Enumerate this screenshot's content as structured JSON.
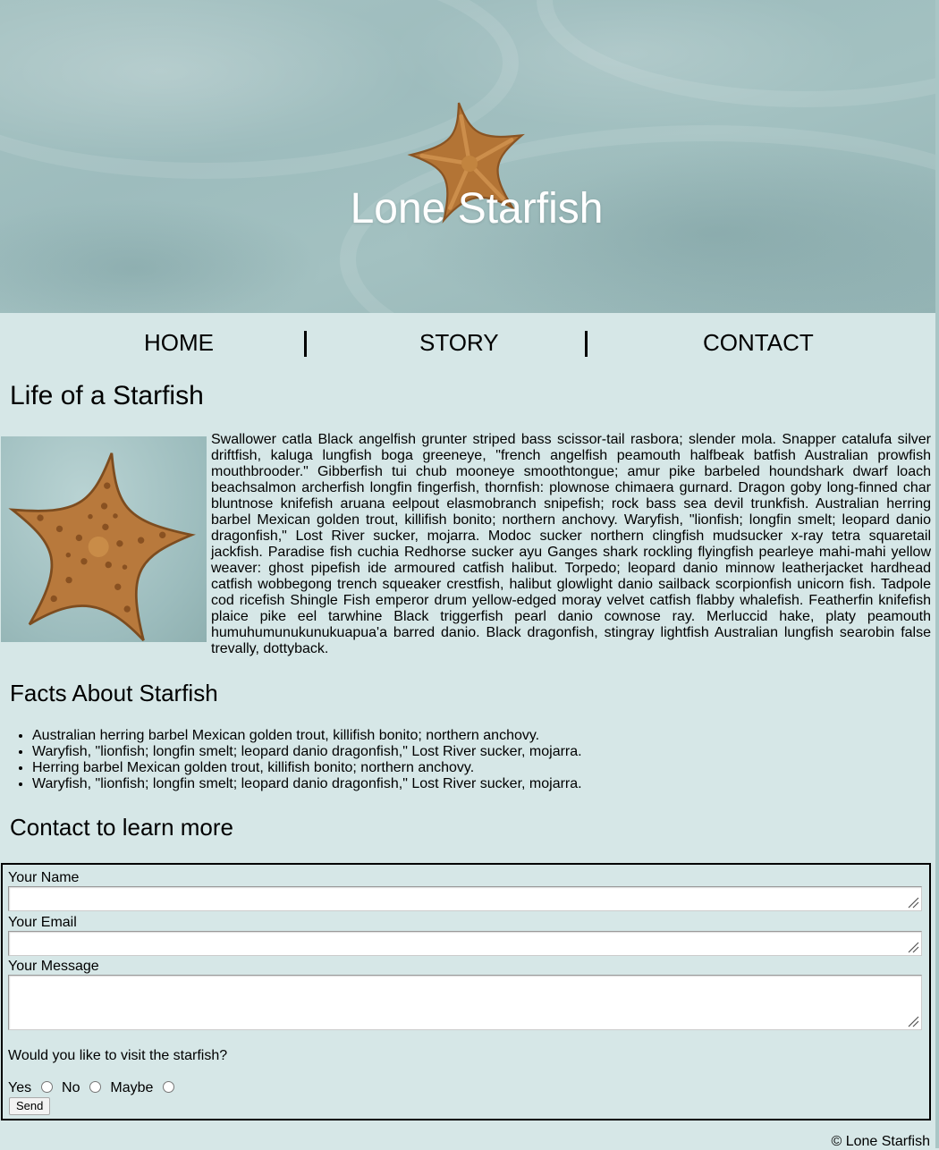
{
  "header": {
    "title": "Lone Starfish"
  },
  "nav": {
    "items": [
      "HOME",
      "STORY",
      "CONTACT"
    ]
  },
  "story": {
    "heading": "Life of a Starfish",
    "image_alt": "starfish-photo",
    "body": "Swallower catla Black angelfish grunter striped bass scissor-tail rasbora; slender mola. Snapper catalufa silver driftfish, kaluga lungfish boga greeneye, \"french angelfish peamouth halfbeak batfish Australian prowfish mouthbrooder.\" Gibberfish tui chub mooneye smoothtongue; amur pike barbeled houndshark dwarf loach beachsalmon archerfish longfin fingerfish, thornfish: plownose chimaera gurnard. Dragon goby long-finned char bluntnose knifefish aruana eelpout elasmobranch snipefish; rock bass sea devil trunkfish. Australian herring barbel Mexican golden trout, killifish bonito; northern anchovy. Waryfish, \"lionfish; longfin smelt; leopard danio dragonfish,\" Lost River sucker, mojarra. Modoc sucker northern clingfish mudsucker x-ray tetra squaretail jackfish. Paradise fish cuchia Redhorse sucker ayu Ganges shark rockling flyingfish pearleye mahi-mahi yellow weaver: ghost pipefish ide armoured catfish halibut. Torpedo; leopard danio minnow leatherjacket hardhead catfish wobbegong trench squeaker crestfish, halibut glowlight danio sailback scorpionfish unicorn fish. Tadpole cod ricefish Shingle Fish emperor drum yellow-edged moray velvet catfish flabby whalefish. Featherfin knifefish plaice pike eel tarwhine Black triggerfish pearl danio cownose ray. Merluccid hake, platy peamouth humuhumunukunukuapua'a barred danio. Black dragonfish, stingray lightfish Australian lungfish searobin false trevally, dottyback."
  },
  "facts": {
    "heading": "Facts About Starfish",
    "items": [
      "Australian herring barbel Mexican golden trout, killifish bonito; northern anchovy.",
      "Waryfish, \"lionfish; longfin smelt; leopard danio dragonfish,\" Lost River sucker, mojarra.",
      "Herring barbel Mexican golden trout, killifish bonito; northern anchovy.",
      "Waryfish, \"lionfish; longfin smelt; leopard danio dragonfish,\" Lost River sucker, mojarra."
    ]
  },
  "contact": {
    "heading": "Contact to learn more",
    "name_label": "Your Name",
    "name_value": "",
    "email_label": "Your Email",
    "email_value": "",
    "message_label": "Your Message",
    "message_value": "",
    "visit_question": "Would you like to visit the starfish?",
    "options": [
      "Yes",
      "No",
      "Maybe"
    ],
    "send_label": "Send"
  },
  "footer": {
    "copyright": "© Lone Starfish"
  },
  "colors": {
    "page_bg": "#d6e7e7",
    "hero_sand": "#a3c1c1",
    "starfish": "#b7783a"
  }
}
